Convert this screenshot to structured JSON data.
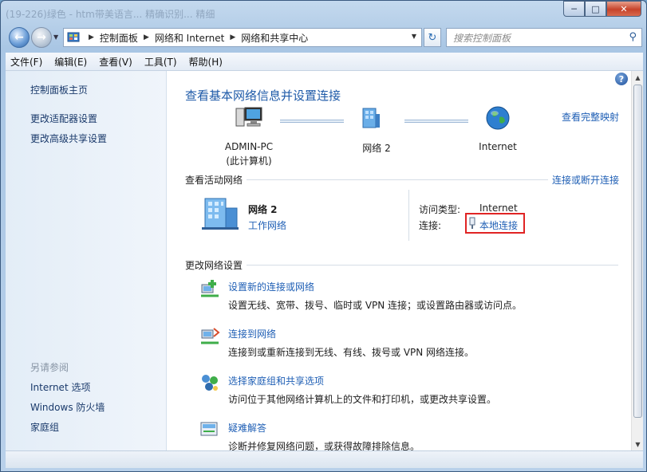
{
  "window": {
    "ghost_title": "(19-226)绿色 - htm带美语言... 精确识别... 精细"
  },
  "nav": {
    "breadcrumb": [
      "控制面板",
      "网络和 Internet",
      "网络和共享中心"
    ],
    "search_placeholder": "搜索控制面板"
  },
  "menu": [
    "文件(F)",
    "编辑(E)",
    "查看(V)",
    "工具(T)",
    "帮助(H)"
  ],
  "sidebar": {
    "home": "控制面板主页",
    "links": [
      "更改适配器设置",
      "更改高级共享设置"
    ],
    "see_also_title": "另请参阅",
    "see_also": [
      "Internet 选项",
      "Windows 防火墙",
      "家庭组"
    ]
  },
  "main": {
    "title": "查看基本网络信息并设置连接",
    "full_map": "查看完整映射",
    "map": {
      "pc_name": "ADMIN-PC",
      "pc_sub": "(此计算机)",
      "network": "网络  2",
      "internet": "Internet"
    },
    "active_title": "查看活动网络",
    "connect_disconnect": "连接或断开连接",
    "active": {
      "name": "网络  2",
      "type": "工作网络",
      "access_label": "访问类型:",
      "access_value": "Internet",
      "conn_label": "连接:",
      "conn_value": "本地连接"
    },
    "change_title": "更改网络设置",
    "tasks": [
      {
        "title": "设置新的连接或网络",
        "desc": "设置无线、宽带、拨号、临时或 VPN 连接；或设置路由器或访问点。"
      },
      {
        "title": "连接到网络",
        "desc": "连接到或重新连接到无线、有线、拨号或 VPN 网络连接。"
      },
      {
        "title": "选择家庭组和共享选项",
        "desc": "访问位于其他网络计算机上的文件和打印机，或更改共享设置。"
      },
      {
        "title": "疑难解答",
        "desc": "诊断并修复网络问题，或获得故障排除信息。"
      }
    ]
  },
  "colors": {
    "link": "#1f5fb5",
    "title": "#1e5aa8",
    "highlight": "#e02424"
  }
}
